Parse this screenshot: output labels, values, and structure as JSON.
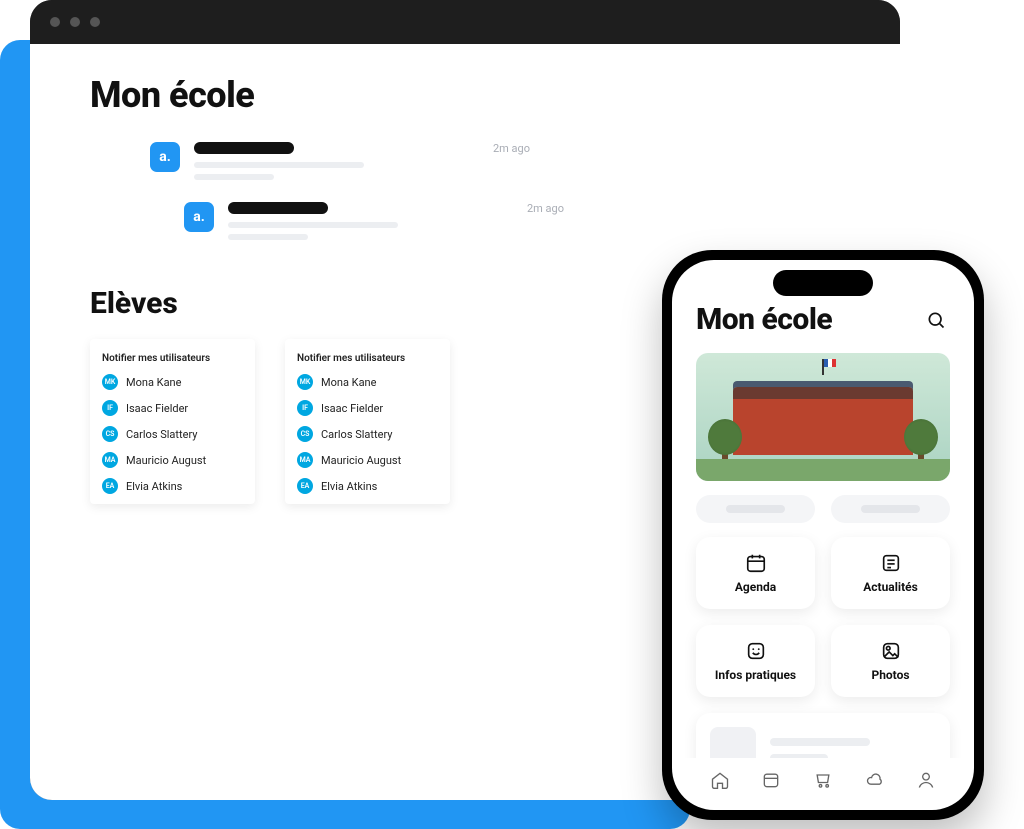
{
  "desktop": {
    "page_title": "Mon école",
    "notifications": [
      {
        "avatar_letter": "a.",
        "time": "2m ago"
      },
      {
        "avatar_letter": "a.",
        "time": "2m ago"
      }
    ],
    "students_section_title": "Elèves",
    "user_card_title": "Notifier mes utilisateurs",
    "users": [
      {
        "initials": "MK",
        "name": "Mona Kane"
      },
      {
        "initials": "IF",
        "name": "Isaac Fielder"
      },
      {
        "initials": "CS",
        "name": "Carlos Slattery"
      },
      {
        "initials": "MA",
        "name": "Mauricio August"
      },
      {
        "initials": "EA",
        "name": "Elvia Atkins"
      }
    ]
  },
  "mobile": {
    "title": "Mon école",
    "tiles": {
      "agenda": "Agenda",
      "actualites": "Actualités",
      "infos": "Infos pratiques",
      "photos": "Photos"
    },
    "nav": {
      "home": "home-icon",
      "calendar": "calendar-icon",
      "cart": "cart-icon",
      "cloud": "cloud-icon",
      "profile": "profile-icon"
    }
  }
}
